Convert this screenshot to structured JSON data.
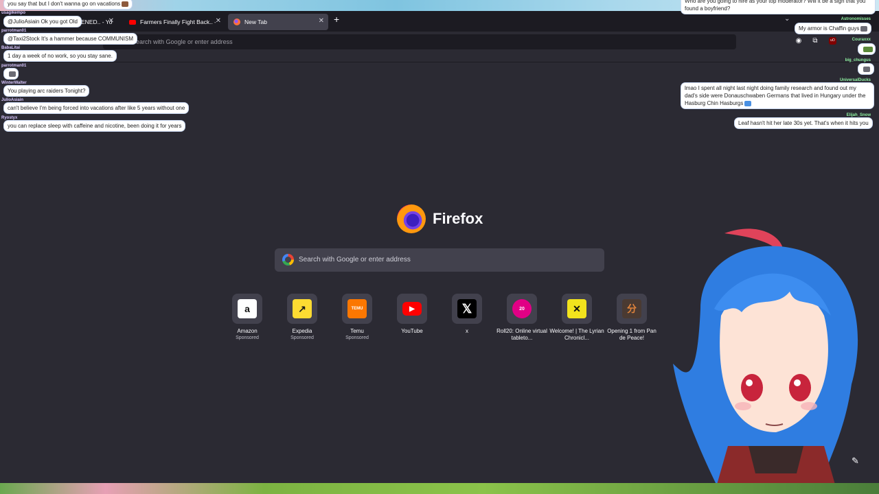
{
  "tabs": [
    {
      "title": "ENED.. - You",
      "favicon": "youtube-icon"
    },
    {
      "title": "Farmers Finally Fight Back.. - Yo",
      "favicon": "youtube-icon"
    },
    {
      "title": "New Tab",
      "favicon": "firefox-icon",
      "active": true
    }
  ],
  "urlbar": {
    "placeholder": "Search with Google or enter address"
  },
  "brand": {
    "name": "Firefox"
  },
  "search": {
    "placeholder": "Search with Google or enter address"
  },
  "shortcuts": [
    {
      "label": "Amazon",
      "sponsor": "Sponsored",
      "icon": "amazon-icon"
    },
    {
      "label": "Expedia",
      "sponsor": "Sponsored",
      "icon": "expedia-icon"
    },
    {
      "label": "Temu",
      "sponsor": "Sponsored",
      "icon": "temu-icon"
    },
    {
      "label": "YouTube",
      "sponsor": "",
      "icon": "youtube-icon"
    },
    {
      "label": "x",
      "sponsor": "",
      "icon": "x-icon"
    },
    {
      "label": "Roll20: Online virtual tableto...",
      "sponsor": "",
      "icon": "roll20-icon"
    },
    {
      "label": "Welcome! | The Lyrian Chronicl...",
      "sponsor": "",
      "icon": "lyrian-icon"
    },
    {
      "label": "Opening 1 from Pan de Peace!",
      "sponsor": "",
      "icon": "pan-de-peace-icon"
    }
  ],
  "chat_left": [
    {
      "user": "",
      "text": "you say that but I don't wanna go on vacations"
    },
    {
      "user": "usagikempo",
      "text": "@JulioAsiain Ok you got Old"
    },
    {
      "user": "parrotman01",
      "text": "@Taxi2Stock It's a hammer because COMMUNISM"
    },
    {
      "user": "BabaLitai",
      "text": "1 day a week of no work, so you stay sane."
    },
    {
      "user": "parrotman01",
      "text": ""
    },
    {
      "user": "WinterWalter",
      "text": "You playing arc raiders Tonight?"
    },
    {
      "user": "JulioAsiain",
      "text": "can't believe I'm being forced into vacations after like 5 years without one"
    },
    {
      "user": "Ryostyx",
      "text": "you can replace sleep with caffeine and nicotine, been doing it for years"
    }
  ],
  "chat_right": [
    {
      "user": "",
      "text": "Who are you going to hire as your top moderator? Will it be a sign that you found a boyfriend?"
    },
    {
      "user": "Astronomisses",
      "text": "My armor is Chaffin guys"
    },
    {
      "user": "Couraxxx",
      "text": ""
    },
    {
      "user": "big_chungus",
      "text": ""
    },
    {
      "user": "UniversalDucks",
      "text": "lmao I spent all night last night doing family research and found out my dad's side were Donauschwaben Germans that lived in Hungary under the Hasburg Chin Hasburgs"
    },
    {
      "user": "Elijah_Snow",
      "text": "Leaf hasn't hit her late 30s yet. That's when it hits you"
    }
  ]
}
